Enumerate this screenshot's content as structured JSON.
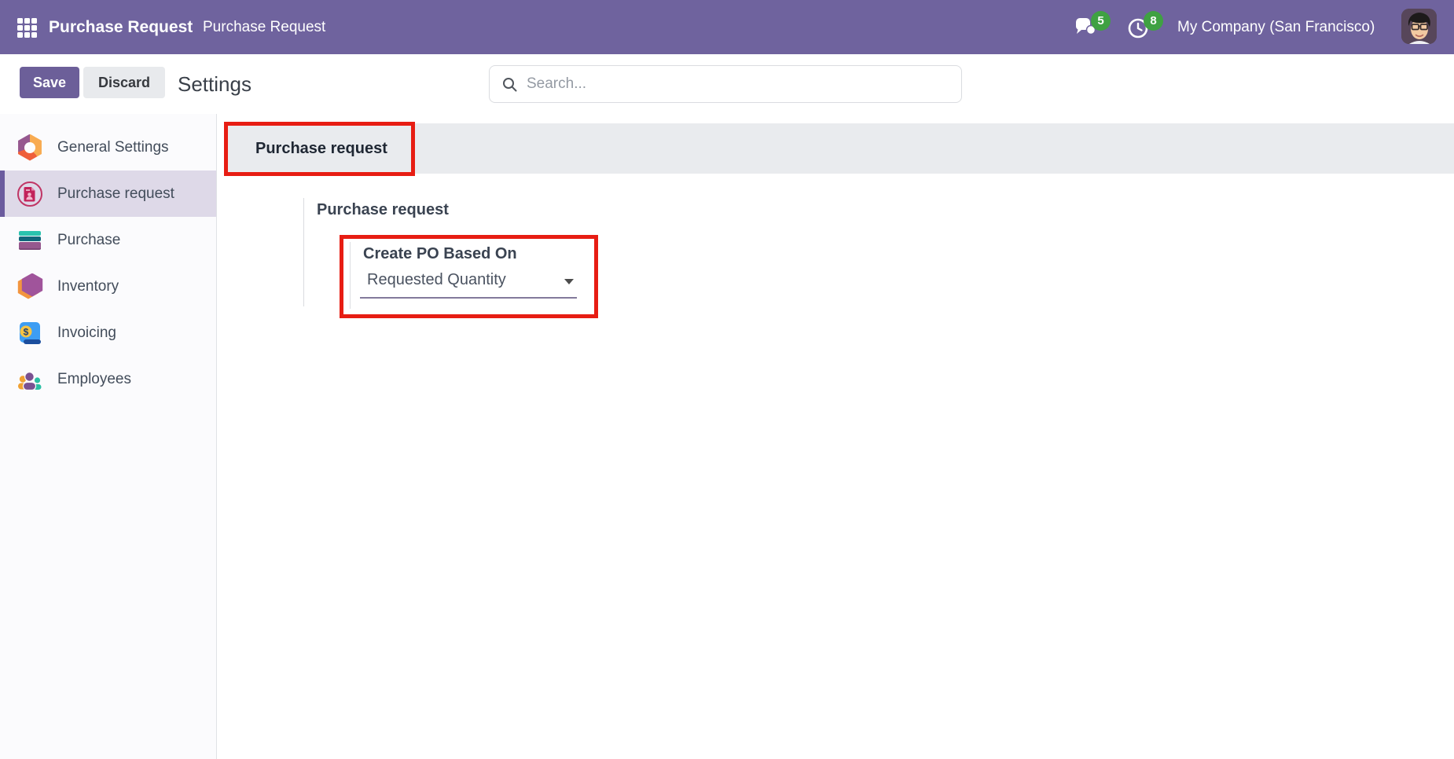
{
  "topbar": {
    "app_name": "Purchase Request",
    "menu_item": "Purchase Request",
    "messages_badge": "5",
    "activities_badge": "8",
    "company": "My Company (San Francisco)"
  },
  "toolbar": {
    "save_label": "Save",
    "discard_label": "Discard",
    "title": "Settings",
    "search_placeholder": "Search..."
  },
  "sidebar": {
    "items": [
      {
        "label": "General Settings",
        "icon": "general-settings-hexagon",
        "selected": false
      },
      {
        "label": "Purchase request",
        "icon": "purchase-request-document",
        "selected": true
      },
      {
        "label": "Purchase",
        "icon": "purchase-stacked-cards",
        "selected": false
      },
      {
        "label": "Inventory",
        "icon": "inventory-hexagon",
        "selected": false
      },
      {
        "label": "Invoicing",
        "icon": "invoicing-dollar-sheet",
        "selected": false
      },
      {
        "label": "Employees",
        "icon": "employees-people",
        "selected": false
      }
    ]
  },
  "main": {
    "tab_label": "Purchase request",
    "section_title": "Purchase request",
    "setting": {
      "label": "Create PO Based On",
      "value": "Requested Quantity"
    }
  },
  "colors": {
    "brand_purple": "#6f639e",
    "annotation_red": "#e71d13",
    "badge_green": "#3fa142",
    "tab_strip_bg": "#e9ebee",
    "selected_item_bg": "#ded9e8"
  }
}
